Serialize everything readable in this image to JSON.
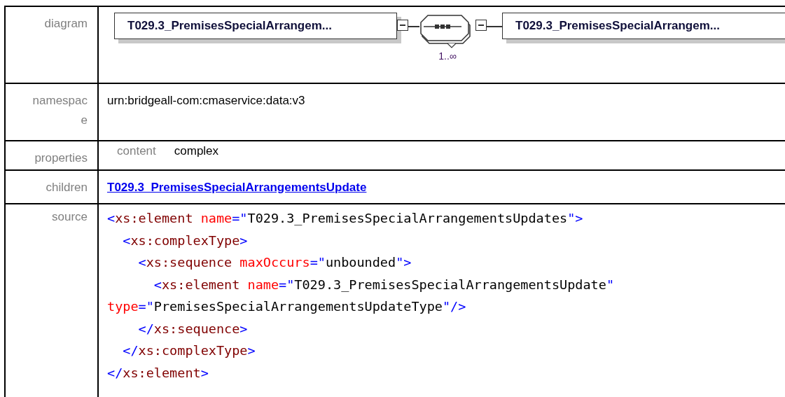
{
  "diagram": {
    "label": "diagram",
    "source_element": "T029.3_PremisesSpecialArrangem...",
    "occurrence": "1..∞",
    "child_element": "T029.3_PremisesSpecialArrangem..."
  },
  "namespace": {
    "label": "namespace",
    "value": "urn:bridgeall-com:cmaservice:data:v3"
  },
  "properties": {
    "label": "properties",
    "items": [
      {
        "name": "content",
        "value": "complex"
      }
    ]
  },
  "children": {
    "label": "children",
    "links": [
      "T029.3_PremisesSpecialArrangementsUpdate"
    ]
  },
  "source": {
    "label": "source",
    "lines": [
      [
        {
          "kind": "punct",
          "text": "<"
        },
        {
          "kind": "tag",
          "text": "xs:element"
        },
        {
          "kind": "attr",
          "text": " name"
        },
        {
          "kind": "punct",
          "text": "=\""
        },
        {
          "kind": "value",
          "text": "T029.3_PremisesSpecialArrangementsUpdates"
        },
        {
          "kind": "punct",
          "text": "\">"
        }
      ],
      [
        {
          "kind": "punct",
          "text": "  <"
        },
        {
          "kind": "tag",
          "text": "xs:complexType"
        },
        {
          "kind": "punct",
          "text": ">"
        }
      ],
      [
        {
          "kind": "punct",
          "text": "    <"
        },
        {
          "kind": "tag",
          "text": "xs:sequence"
        },
        {
          "kind": "attr",
          "text": " maxOccurs"
        },
        {
          "kind": "punct",
          "text": "=\""
        },
        {
          "kind": "value",
          "text": "unbounded"
        },
        {
          "kind": "punct",
          "text": "\">"
        }
      ],
      [
        {
          "kind": "punct",
          "text": "      <"
        },
        {
          "kind": "tag",
          "text": "xs:element"
        },
        {
          "kind": "attr",
          "text": " name"
        },
        {
          "kind": "punct",
          "text": "=\""
        },
        {
          "kind": "value",
          "text": "T029.3_PremisesSpecialArrangementsUpdate"
        },
        {
          "kind": "punct",
          "text": "\""
        }
      ],
      [
        {
          "kind": "attr",
          "text": "type"
        },
        {
          "kind": "punct",
          "text": "=\""
        },
        {
          "kind": "value",
          "text": "PremisesSpecialArrangementsUpdateType"
        },
        {
          "kind": "punct",
          "text": "\"/>"
        }
      ],
      [
        {
          "kind": "punct",
          "text": "    </"
        },
        {
          "kind": "tag",
          "text": "xs:sequence"
        },
        {
          "kind": "punct",
          "text": ">"
        }
      ],
      [
        {
          "kind": "punct",
          "text": "  </"
        },
        {
          "kind": "tag",
          "text": "xs:complexType"
        },
        {
          "kind": "punct",
          "text": ">"
        }
      ],
      [
        {
          "kind": "punct",
          "text": "</"
        },
        {
          "kind": "tag",
          "text": "xs:element"
        },
        {
          "kind": "punct",
          "text": ">"
        }
      ]
    ]
  }
}
